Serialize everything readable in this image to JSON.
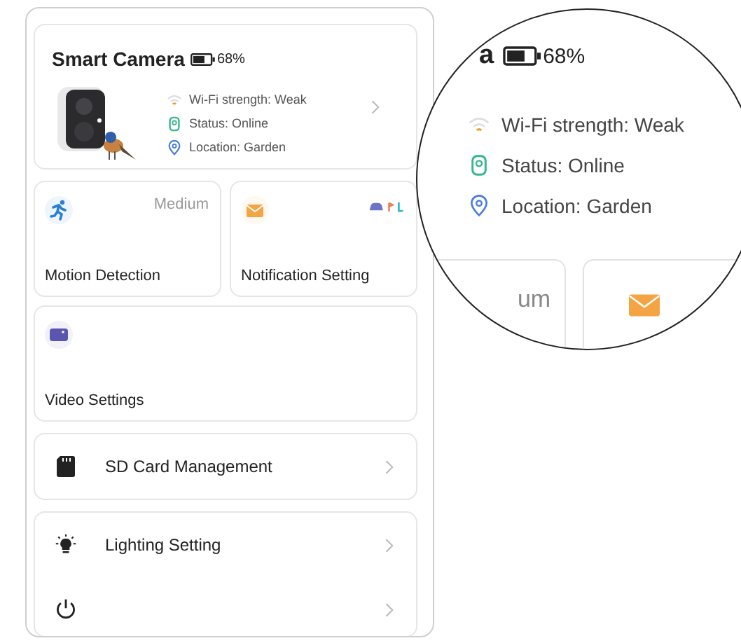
{
  "device": {
    "name": "Smart Camera",
    "battery": {
      "level": 0.68,
      "reading": "68%"
    },
    "info": [
      {
        "kind": "wifi",
        "text": "Wi-Fi strength: Weak"
      },
      {
        "kind": "status",
        "text": "Status: Online"
      },
      {
        "kind": "location",
        "text": "Location: Garden"
      }
    ]
  },
  "tiles": [
    {
      "kind": "motion",
      "label": "Motion Detection",
      "value": "Medium"
    },
    {
      "kind": "notification",
      "label": "Notification Setting"
    },
    {
      "kind": "video",
      "label": "Video Settings"
    }
  ],
  "menu": [
    {
      "kind": "sd",
      "label": "SD Card Management"
    },
    {
      "kind": "light",
      "label": "Lighting Setting"
    },
    {
      "kind": "power"
    }
  ],
  "magnifier": {
    "title_fragment": "a",
    "battery": {
      "level": 0.68,
      "reading": "68%"
    },
    "info": [
      {
        "kind": "wifi",
        "text": "Wi-Fi strength: Weak"
      },
      {
        "kind": "status",
        "text": "Status: Online"
      },
      {
        "kind": "location",
        "text": "Location: Garden"
      }
    ],
    "tile_fragment": "um"
  }
}
